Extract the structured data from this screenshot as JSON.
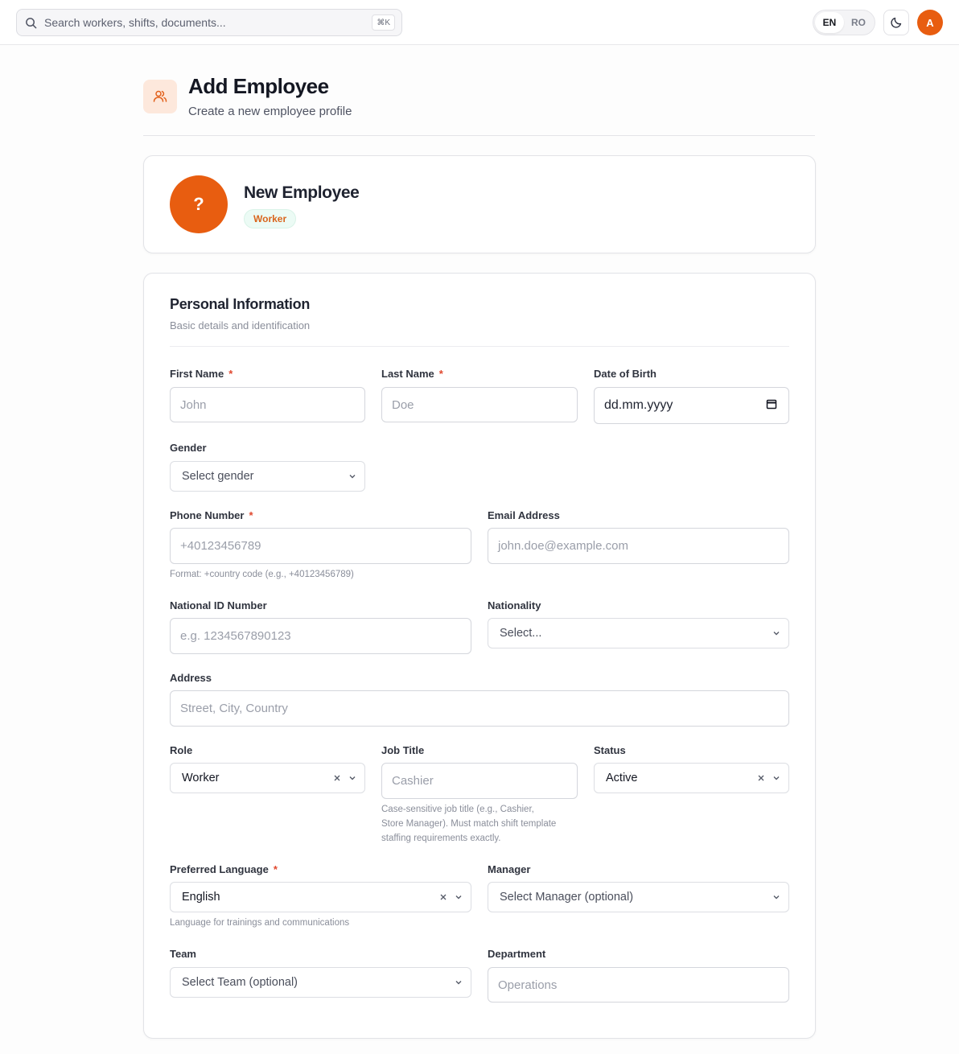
{
  "topbar": {
    "search_placeholder": "Search workers, shifts, documents...",
    "search_shortcut": "⌘K",
    "languages": [
      "EN",
      "RO"
    ],
    "active_language": "EN",
    "user_initial": "A"
  },
  "header": {
    "title": "Add Employee",
    "subtitle": "Create a new employee profile"
  },
  "profile": {
    "avatar_placeholder": "?",
    "name": "New Employee",
    "role_badge": "Worker"
  },
  "section": {
    "title": "Personal Information",
    "subtitle": "Basic details and identification"
  },
  "fields": {
    "first_name": {
      "label": "First Name",
      "required_mark": "*",
      "placeholder": "John"
    },
    "last_name": {
      "label": "Last Name",
      "required_mark": "*",
      "placeholder": "Doe"
    },
    "dob": {
      "label": "Date of Birth",
      "value": "dd.mm.yyyy"
    },
    "gender": {
      "label": "Gender",
      "placeholder": "Select gender"
    },
    "phone": {
      "label": "Phone Number",
      "required_mark": "*",
      "placeholder": "+40123456789",
      "hint": "Format: +country code (e.g., +40123456789)"
    },
    "email": {
      "label": "Email Address",
      "placeholder": "john.doe@example.com"
    },
    "national_id": {
      "label": "National ID Number",
      "placeholder": "e.g. 1234567890123"
    },
    "nationality": {
      "label": "Nationality",
      "placeholder": "Select..."
    },
    "address": {
      "label": "Address",
      "placeholder": "Street, City, Country"
    },
    "role": {
      "label": "Role",
      "value": "Worker"
    },
    "job_title": {
      "label": "Job Title",
      "placeholder": "Cashier",
      "hint_lines": [
        "Case-sensitive job title (e.g., Cashier,",
        "Store Manager). Must match shift template",
        "staffing requirements exactly."
      ]
    },
    "status": {
      "label": "Status",
      "value": "Active"
    },
    "preferred_language": {
      "label": "Preferred Language",
      "required_mark": "*",
      "value": "English",
      "hint": "Language for trainings and communications"
    },
    "manager": {
      "label": "Manager",
      "placeholder": "Select Manager (optional)"
    },
    "team": {
      "label": "Team",
      "placeholder": "Select Team (optional)"
    },
    "department": {
      "label": "Department",
      "placeholder": "Operations"
    }
  },
  "colors": {
    "brand": "#e85d10",
    "required": "#e0482f",
    "badge_bg": "#ecfbf5"
  }
}
